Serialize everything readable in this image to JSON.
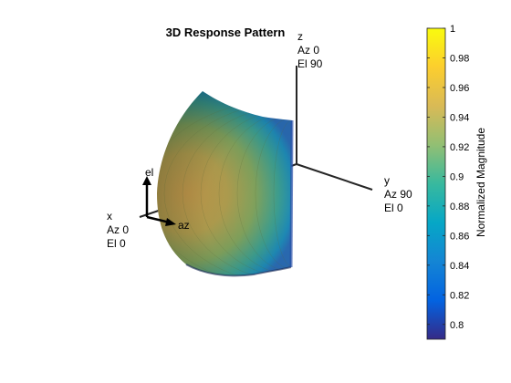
{
  "chart_data": {
    "type": "surface3d",
    "title": "3D Response Pattern",
    "colorbar": {
      "label": "Normalized Magnitude",
      "range": [
        0.79,
        1.0
      ],
      "ticks": [
        "0.8",
        "0.82",
        "0.84",
        "0.86",
        "0.88",
        "0.9",
        "0.92",
        "0.94",
        "0.96",
        "0.98",
        "1"
      ],
      "tick_values": [
        0.8,
        0.82,
        0.84,
        0.86,
        0.88,
        0.9,
        0.92,
        0.94,
        0.96,
        0.98,
        1.0
      ],
      "colormap": "parula",
      "colormap_stops": [
        "#352a87",
        "#0363e1",
        "#1485d4",
        "#06a7c6",
        "#38b99e",
        "#92bf73",
        "#d9ba56",
        "#fcce2e",
        "#f9fb0e"
      ]
    },
    "axes": {
      "x": {
        "name": "x",
        "az": "Az 0",
        "el": "El 0"
      },
      "y": {
        "name": "y",
        "az": "Az 90",
        "el": "El 0"
      },
      "z": {
        "name": "z",
        "az": "Az 0",
        "el": "El 90"
      }
    },
    "local_axes": {
      "elevation": "el",
      "azimuth": "az"
    }
  }
}
